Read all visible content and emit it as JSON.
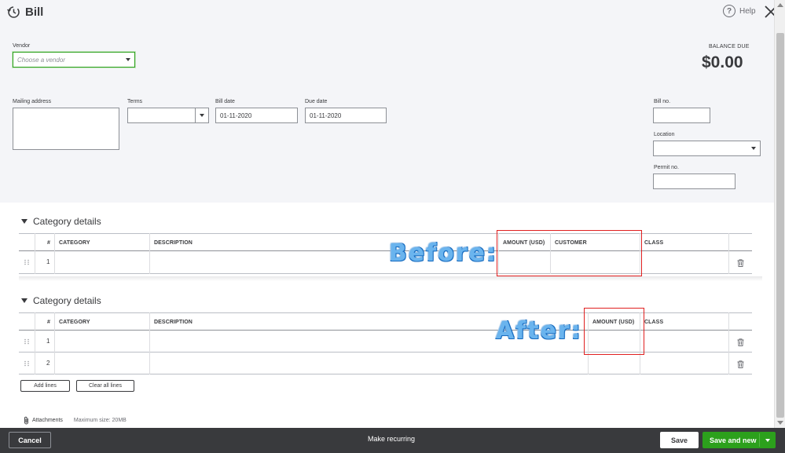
{
  "window": {
    "title": "Bill"
  },
  "header": {
    "help_label": "Help",
    "vendor": {
      "label": "Vendor",
      "placeholder": "Choose a vendor"
    },
    "balance_due": {
      "label": "BALANCE DUE",
      "value": "$0.00"
    },
    "mailing_address": {
      "label": "Mailing address",
      "value": ""
    },
    "terms": {
      "label": "Terms",
      "value": ""
    },
    "bill_date": {
      "label": "Bill date",
      "value": "01-11-2020"
    },
    "due_date": {
      "label": "Due date",
      "value": "01-11-2020"
    },
    "bill_no": {
      "label": "Bill no.",
      "value": ""
    },
    "location": {
      "label": "Location",
      "value": ""
    },
    "permit_no": {
      "label": "Permit no.",
      "value": ""
    }
  },
  "before_section": {
    "title": "Category details",
    "columns": [
      "#",
      "CATEGORY",
      "DESCRIPTION",
      "AMOUNT (USD)",
      "CUSTOMER",
      "CLASS"
    ],
    "rows": [
      {
        "num": "1"
      }
    ],
    "annotation": "Before:"
  },
  "after_section": {
    "title": "Category details",
    "columns": [
      "#",
      "CATEGORY",
      "DESCRIPTION",
      "AMOUNT (USD)",
      "CLASS"
    ],
    "rows": [
      {
        "num": "1"
      },
      {
        "num": "2"
      }
    ],
    "annotation": "After:",
    "add_lines_label": "Add lines",
    "clear_lines_label": "Clear all lines"
  },
  "attachments": {
    "label": "Attachments",
    "max_size": "Maximum size: 20MB"
  },
  "footer": {
    "cancel_label": "Cancel",
    "recurring_label": "Make recurring",
    "save_label": "Save",
    "save_new_label": "Save and new"
  },
  "colors": {
    "accent_green": "#2ca01c",
    "footer_bg": "#393a3d",
    "annotation_red": "#e02020",
    "annotation_blue": "#6ab4ee"
  }
}
